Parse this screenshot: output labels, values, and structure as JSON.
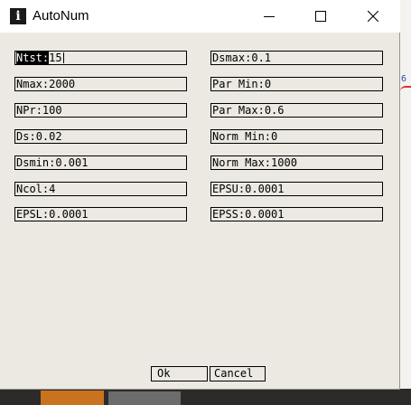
{
  "window": {
    "title": "AutoNum",
    "icon": "info-icon"
  },
  "titlebar_buttons": [
    "minimize-icon",
    "maximize-icon",
    "close-icon"
  ],
  "fields_left": [
    {
      "label": "Ntst",
      "value": "15"
    },
    {
      "label": "Nmax",
      "value": "2000"
    },
    {
      "label": "NPr",
      "value": "100"
    },
    {
      "label": "Ds",
      "value": "0.02"
    },
    {
      "label": "Dsmin",
      "value": "0.001"
    },
    {
      "label": "Ncol",
      "value": "4"
    },
    {
      "label": "EPSL",
      "value": "0.0001"
    }
  ],
  "fields_right": [
    {
      "label": "Dsmax",
      "value": "0.1"
    },
    {
      "label": "Par Min",
      "value": "0"
    },
    {
      "label": "Par Max",
      "value": "0.6"
    },
    {
      "label": "Norm Min",
      "value": "0"
    },
    {
      "label": "Norm Max",
      "value": "1000"
    },
    {
      "label": "EPSU",
      "value": "0.0001"
    },
    {
      "label": "EPSS",
      "value": "0.0001"
    }
  ],
  "separator": ":",
  "buttons": {
    "ok": "Ok",
    "cancel": "Cancel"
  },
  "background": {
    "partial_text": "6"
  }
}
